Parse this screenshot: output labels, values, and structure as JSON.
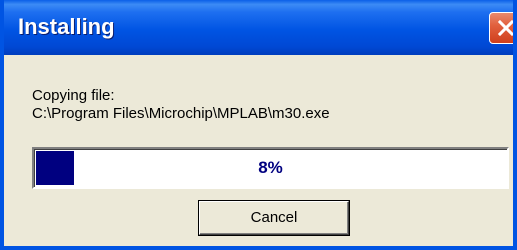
{
  "window": {
    "title": "Installing",
    "close_icon": "close-icon"
  },
  "status": {
    "label": "Copying file:",
    "file_path": "C:\\Program Files\\Microchip\\MPLAB\\m30.exe"
  },
  "progress": {
    "percent": 8,
    "text": "8%",
    "fill_color": "#000080"
  },
  "buttons": {
    "cancel_label": "Cancel"
  },
  "colors": {
    "titlebar": "#0054e3",
    "close_button": "#e2613f",
    "background": "#ece9d8"
  }
}
